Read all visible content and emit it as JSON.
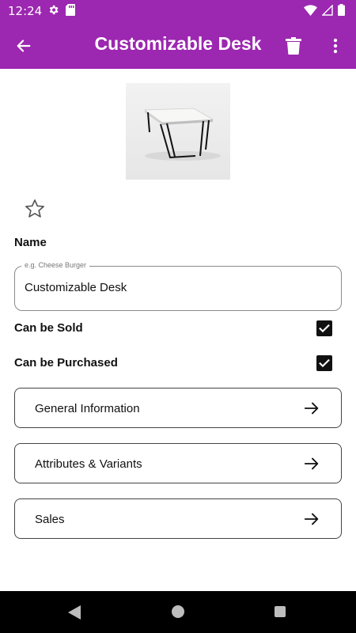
{
  "status_bar": {
    "time": "12:24",
    "icons": [
      "gear-icon",
      "sd-card-icon",
      "wifi-icon",
      "signal-icon",
      "battery-icon"
    ]
  },
  "app_bar": {
    "title": "Customizable Desk",
    "background_color": "#9c27b0",
    "icons": [
      "back-arrow-icon",
      "delete-icon",
      "more-vert-icon"
    ]
  },
  "product": {
    "image_alt": "desk-image",
    "favorite_icon": "star-outline-icon"
  },
  "form": {
    "name_label": "Name",
    "name_placeholder": "e.g. Cheese Burger",
    "name_value": "Customizable Desk",
    "can_be_sold": {
      "label": "Can be Sold",
      "checked": true
    },
    "can_be_purchased": {
      "label": "Can be Purchased",
      "checked": true
    }
  },
  "sections": [
    {
      "label": "General Information",
      "icon": "arrow-right-icon"
    },
    {
      "label": "Attributes & Variants",
      "icon": "arrow-right-icon"
    },
    {
      "label": "Sales",
      "icon": "arrow-right-icon"
    }
  ],
  "system_nav": {
    "icons": [
      "nav-back-icon",
      "nav-home-icon",
      "nav-recents-icon"
    ]
  }
}
